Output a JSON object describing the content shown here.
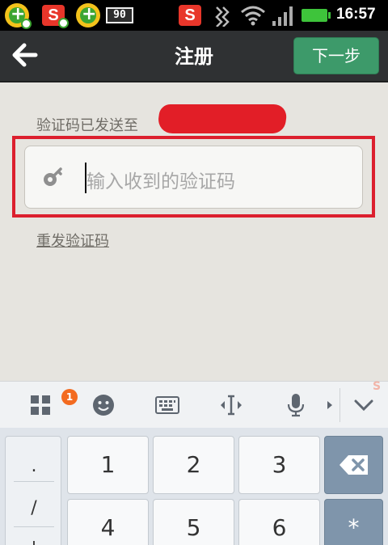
{
  "status_bar": {
    "sogou_letter": "S",
    "battery_percent": "90",
    "time": "16:57"
  },
  "header": {
    "title": "注册",
    "next_button": "下一步"
  },
  "form": {
    "sent_label": "验证码已发送至",
    "code_placeholder": "输入收到的验证码",
    "resend_link": "重发验证码"
  },
  "keyboard": {
    "apps_badge": "1",
    "side_symbols": [
      ".",
      "/",
      "+"
    ],
    "keys": [
      "1",
      "2",
      "3",
      "4",
      "5",
      "6"
    ],
    "asterisk": "*",
    "watermark": "S"
  },
  "colors": {
    "accent_green": "#3d9a6a",
    "highlight_red": "#dc1f2e",
    "title_bar": "#2f3133"
  }
}
